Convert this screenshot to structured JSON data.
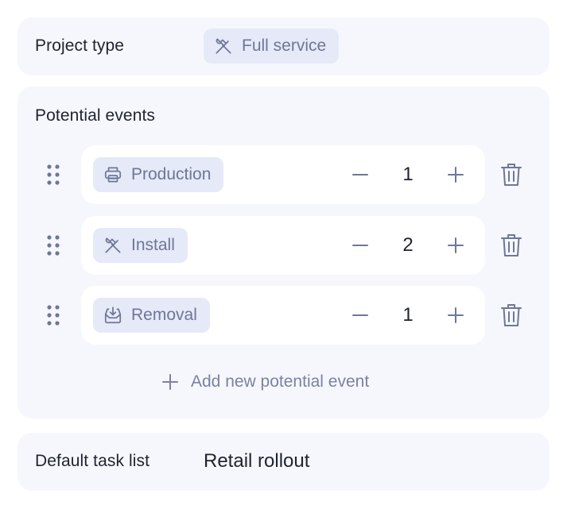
{
  "project": {
    "label": "Project type",
    "value": "Full service",
    "icon": "hammer-wrench-icon"
  },
  "events": {
    "title": "Potential events",
    "items": [
      {
        "label": "Production",
        "icon": "printer-icon",
        "quantity": "1"
      },
      {
        "label": "Install",
        "icon": "hammer-wrench-icon",
        "quantity": "2"
      },
      {
        "label": "Removal",
        "icon": "tray-download-icon",
        "quantity": "1"
      }
    ],
    "add_label": "Add new potential event"
  },
  "default_task_list": {
    "label": "Default task list",
    "value": "Retail rollout"
  },
  "colors": {
    "card_bg": "#f6f7fd",
    "chip_bg": "#e6e9f8",
    "muted_text": "#6e7796",
    "icon_gray": "#7a82a0"
  }
}
